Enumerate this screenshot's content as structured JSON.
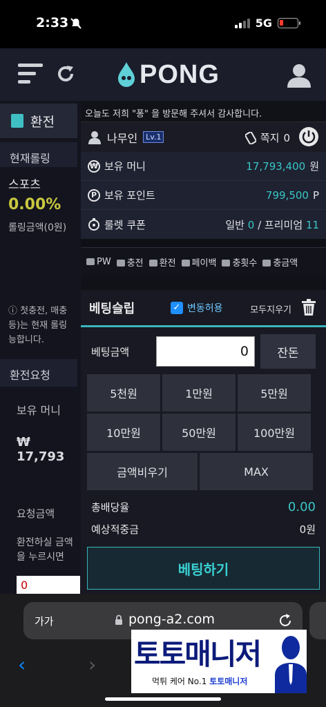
{
  "status_bar": {
    "time": "2:33",
    "network": "5G"
  },
  "app_header": {
    "logo_text": "PONG"
  },
  "background_page": {
    "tab_label": "환전",
    "rolling_title": "현재롤링",
    "sports_label": "스포츠",
    "rolling_percent": "0.00%",
    "rolling_amount": "롤링금액(0원)",
    "note": "ⓘ 첫충전, 매충등)는 현재 롤링 능합니다.",
    "exchange_title": "환전요청",
    "held_money_label": "보유 머니",
    "held_money_value": "₩ 17,793",
    "request_amount_label": "요청금액",
    "request_note": "환전하실 금액을 누르시면",
    "request_input": "0"
  },
  "panel": {
    "notice": "오늘도 저희 \"퐁\" 을 방문해 주셔서 감사합니다.",
    "user_name": "나무인",
    "level": "Lv.1",
    "memo_label": "쪽지",
    "memo_count": "0",
    "money_label": "보유 머니",
    "money_value": "17,793,400",
    "money_unit": "원",
    "points_label": "보유 포인트",
    "points_value": "799,500",
    "points_unit": "P",
    "coupon_label": "룰렛 쿠폰",
    "coupon_general_label": "일반",
    "coupon_general": "0",
    "coupon_premium_label": "/ 프리미엄",
    "coupon_premium": "11",
    "quick_links": [
      "PW",
      "충전",
      "환전",
      "페이백",
      "충횟수",
      "충금액"
    ]
  },
  "bet_slip": {
    "title": "베팅슬립",
    "allow_change_label": "변동허용",
    "allow_change_checked": true,
    "clear_all_label": "모두지우기",
    "amount_label": "베팅금액",
    "amount_value": "0",
    "change_button": "잔돈",
    "chips": [
      "5천원",
      "1만원",
      "5만원",
      "10만원",
      "50만원",
      "100만원"
    ],
    "clear_amount_button": "금액비우기",
    "max_button": "MAX",
    "total_odds_label": "총배당율",
    "total_odds_value": "0.00",
    "expected_win_label": "예상적중금",
    "expected_win_value": "0원",
    "bet_button": "베팅하기"
  },
  "safari": {
    "text_size_label": "가가",
    "url": "pong-a2.com"
  },
  "watermark": {
    "title": "토토매니저",
    "subtitle_prefix": "먹튀 케어 No.1",
    "subtitle_brand": "토토매니저"
  },
  "colors": {
    "accent": "#3ab7bd",
    "value_teal": "#38c6c6",
    "header_bg": "#1b1d2b"
  }
}
